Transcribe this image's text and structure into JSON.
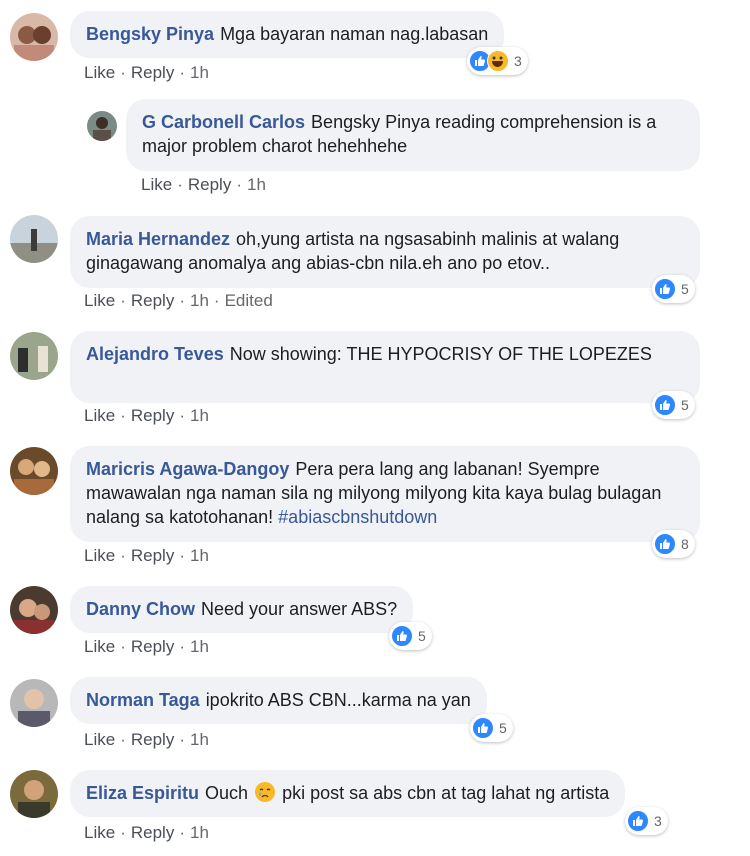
{
  "comments": [
    {
      "author": "Bengsky Pinya",
      "text": "Mga bayaran naman nag.labasan",
      "actions": {
        "like": "Like",
        "reply": "Reply",
        "time": "1h"
      },
      "reactions": {
        "types": [
          "like",
          "haha"
        ],
        "count": "3"
      }
    },
    {
      "author": "G Carbonell Carlos",
      "text": "Bengsky Pinya reading comprehension is a major problem charot hehehhehe",
      "actions": {
        "like": "Like",
        "reply": "Reply",
        "time": "1h"
      }
    },
    {
      "author": "Maria Hernandez",
      "text": "oh,yung artista na ngsasabinh malinis at walang ginagawang anomalya ang abias-cbn nila.eh ano po etov..",
      "actions": {
        "like": "Like",
        "reply": "Reply",
        "time": "1h",
        "edited": "Edited"
      },
      "reactions": {
        "types": [
          "like"
        ],
        "count": "5"
      }
    },
    {
      "author": "Alejandro Teves",
      "text": "Now showing: THE HYPOCRISY OF THE LOPEZES",
      "actions": {
        "like": "Like",
        "reply": "Reply",
        "time": "1h"
      },
      "reactions": {
        "types": [
          "like"
        ],
        "count": "5"
      }
    },
    {
      "author": "Maricris Agawa-Dangoy",
      "text": "Pera pera lang ang labanan! Syempre mawawalan nga naman sila ng milyong milyong kita kaya bulag bulagan nalang sa katotohanan!",
      "hashtag": "#abiascbnshutdown",
      "actions": {
        "like": "Like",
        "reply": "Reply",
        "time": "1h"
      },
      "reactions": {
        "types": [
          "like"
        ],
        "count": "8"
      }
    },
    {
      "author": "Danny Chow",
      "text": "Need your answer ABS?",
      "actions": {
        "like": "Like",
        "reply": "Reply",
        "time": "1h"
      },
      "reactions": {
        "types": [
          "like"
        ],
        "count": "5"
      }
    },
    {
      "author": "Norman Taga",
      "text": "ipokrito ABS CBN...karma na yan",
      "actions": {
        "like": "Like",
        "reply": "Reply",
        "time": "1h"
      },
      "reactions": {
        "types": [
          "like"
        ],
        "count": "5"
      }
    },
    {
      "author": "Eliza Espiritu",
      "text_before": "Ouch",
      "emoji": "crying-face",
      "text_after": "pki post sa abs cbn at tag lahat ng artista",
      "actions": {
        "like": "Like",
        "reply": "Reply",
        "time": "1h"
      },
      "reactions": {
        "types": [
          "like"
        ],
        "count": "3"
      }
    }
  ],
  "colors": {
    "author": "#385898",
    "bubble": "#f0f2f5",
    "like": "#2d88ff",
    "haha": "#f7b928",
    "meta": "#65676b"
  }
}
